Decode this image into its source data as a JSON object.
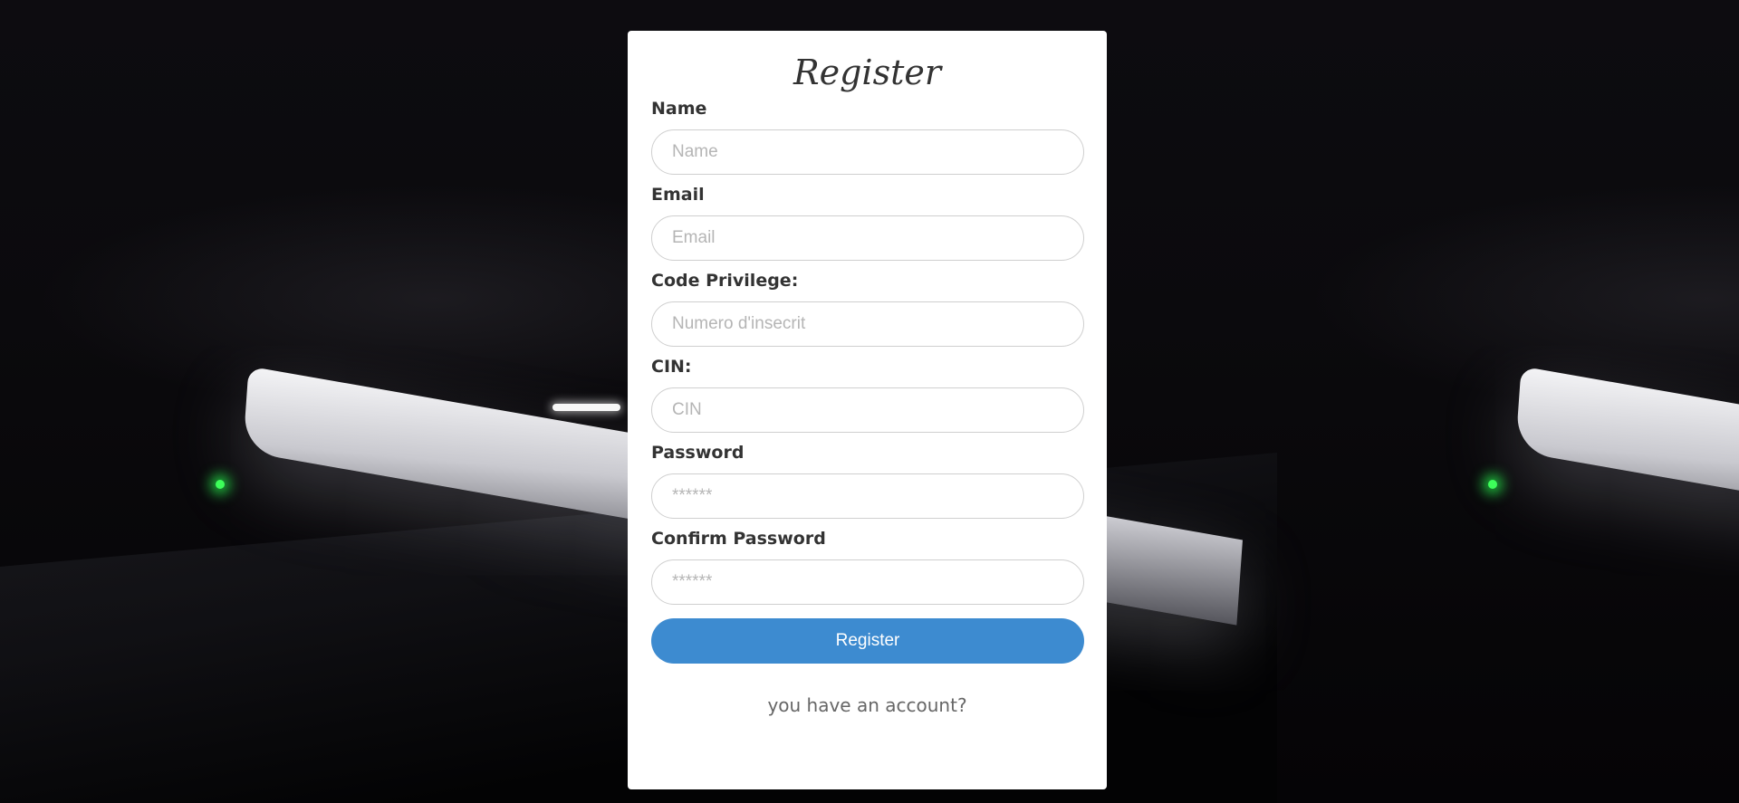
{
  "form": {
    "title": "Register",
    "fields": [
      {
        "label": "Name",
        "placeholder": "Name",
        "value": ""
      },
      {
        "label": "Email",
        "placeholder": "Email",
        "value": ""
      },
      {
        "label": "Code Privilege:",
        "placeholder": "Numero d'insecrit",
        "value": ""
      },
      {
        "label": "CIN:",
        "placeholder": "CIN",
        "value": ""
      },
      {
        "label": "Password",
        "placeholder": "******",
        "value": ""
      },
      {
        "label": "Confirm Password",
        "placeholder": "******",
        "value": ""
      }
    ],
    "submit_label": "Register",
    "login_link": "you have an account?"
  },
  "colors": {
    "button": "#3d8bd0",
    "card": "#ffffff",
    "background": "#08070a"
  }
}
